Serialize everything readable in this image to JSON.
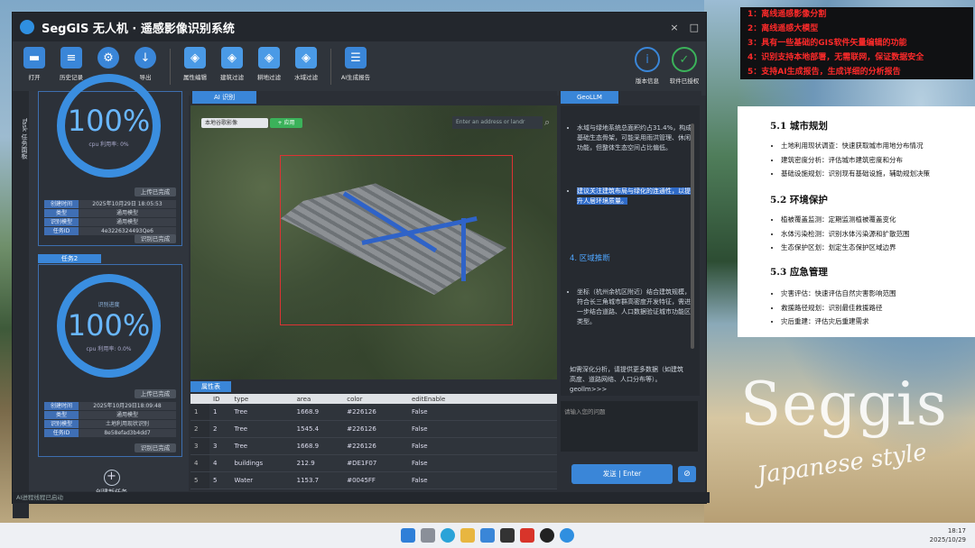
{
  "window": {
    "title": "SegGIS 无人机 · 遥感影像识别系统",
    "close": "×",
    "minimize": "□"
  },
  "toolbar": [
    {
      "label": "打开",
      "icon": "folder-icon",
      "color": "#3a86d8"
    },
    {
      "label": "历史记录",
      "icon": "clipboard-icon",
      "color": "#3a86d8"
    },
    {
      "label": "设置",
      "icon": "gear-icon",
      "color": "#3a86d8"
    },
    {
      "label": "导出",
      "icon": "download-icon",
      "color": "#3a86d8"
    },
    {
      "label": "属性编辑",
      "icon": "cube-edit-icon",
      "color": "#3a86d8"
    },
    {
      "label": "建筑过滤",
      "icon": "cube-filter-icon",
      "color": "#3a86d8"
    },
    {
      "label": "耕地过滤",
      "icon": "cube-filter-icon",
      "color": "#3a86d8"
    },
    {
      "label": "水域过滤",
      "icon": "cube-filter-icon",
      "color": "#3a86d8"
    },
    {
      "label": "AI生成报告",
      "icon": "report-icon",
      "color": "#3a86d8"
    }
  ],
  "toolbar_right": [
    {
      "label": "版本信息",
      "icon": "info-icon",
      "color": "#3a86d8"
    },
    {
      "label": "软件已授权",
      "icon": "check-circle-icon",
      "color": "#3bb25a"
    }
  ],
  "left": {
    "vtab": "Task 任务面板",
    "task1": {
      "pct": "100%",
      "usage": "cpu 利用率: 0%",
      "upload": "上传已完成",
      "rows": [
        [
          "创建时间",
          "2025年10月29日 18:05:53"
        ],
        [
          "类型",
          "通用模型"
        ],
        [
          "识别模型",
          "通用模型"
        ],
        [
          "任务ID",
          "4e3226324493Qe6"
        ]
      ],
      "status": "识别已完成"
    },
    "task2": {
      "tab": "任务2",
      "caption": "识别进度",
      "pct": "100%",
      "usage": "cpu 利用率: 0.0%",
      "upload": "上传已完成",
      "rows": [
        [
          "创建时间",
          "2025年10月29日18:09:48"
        ],
        [
          "类型",
          "通用模型"
        ],
        [
          "识别模型",
          "土地利用现状识别"
        ],
        [
          "任务ID",
          "8e58efad3b4dd7"
        ]
      ],
      "status": "识别已完成"
    },
    "new_task": "创建新任务"
  },
  "center": {
    "tab": "AI 识别",
    "basemap": "本地谷歌影像",
    "apply": "+ 应用",
    "search_placeholder": "Enter an address or landr",
    "attr_tab": "属性表",
    "columns": [
      "ID",
      "type",
      "area",
      "color",
      "editEnable"
    ],
    "rows": [
      [
        "1",
        "1",
        "Tree",
        "1668.9",
        "#226126",
        "False"
      ],
      [
        "2",
        "2",
        "Tree",
        "1545.4",
        "#226126",
        "False"
      ],
      [
        "3",
        "3",
        "Tree",
        "1668.9",
        "#226126",
        "False"
      ],
      [
        "4",
        "4",
        "buildings",
        "212.9",
        "#DE1F07",
        "False"
      ],
      [
        "5",
        "5",
        "Water",
        "1153.7",
        "#0045FF",
        "False"
      ]
    ]
  },
  "right": {
    "tab": "GeoLLM",
    "p1": "水域与绿地系统总面积约占31.4%，构成基础生态骨架，可能采用雨洪管理、休闲功能，但整体生态空间占比偏低。",
    "hl": "建议关注建筑布局与绿化的连通性，以提升人居环境质量。",
    "h4": "4. 区域推断",
    "p2": "坐标（杭州余杭区附近）结合建筑规模，符合长三角城市群高密度开发特征，需进一步结合道路、人口数据验证城市功能区类型。",
    "p3": "如需深化分析，请提供更多数据（如建筑高度、道路网络、人口分布等）。",
    "p3b": "geollm>>>",
    "input_placeholder": "请输入您的问题",
    "send": "发送 | Enter",
    "attach": "⊘"
  },
  "statusbar": "AI进程线程已启动",
  "overlay_red": [
    "1：离线遥感影像分割",
    "2：离线遥感大模型",
    "3：具有一些基础的GIS软件矢量编辑的功能",
    "4：识别支持本地部署，无需联网，保证数据安全",
    "5：支持AI生成报告，生成详细的分析报告"
  ],
  "doc": {
    "s1": "5.1 城市规划",
    "s1_items": [
      "土地利用现状调查：快速获取城市用地分布情况",
      "建筑密度分析：评估城市建筑密度和分布",
      "基础设施规划：识别现有基础设施，辅助规划决策"
    ],
    "s2": "5.2 环境保护",
    "s2_items": [
      "植被覆盖监测：定期监测植被覆盖变化",
      "水体污染检测：识别水体污染源和扩散范围",
      "生态保护区划：划定生态保护区域边界"
    ],
    "s3": "5.3 应急管理",
    "s3_items": [
      "灾害评估：快速评估自然灾害影响范围",
      "救援路径规划：识别最佳救援路径",
      "灾后重建：评估灾后重建需求"
    ]
  },
  "brand": {
    "seggis": "Seggis",
    "style": "Japanese style"
  },
  "clock": {
    "time": "18:17",
    "date": "2025/10/29"
  }
}
